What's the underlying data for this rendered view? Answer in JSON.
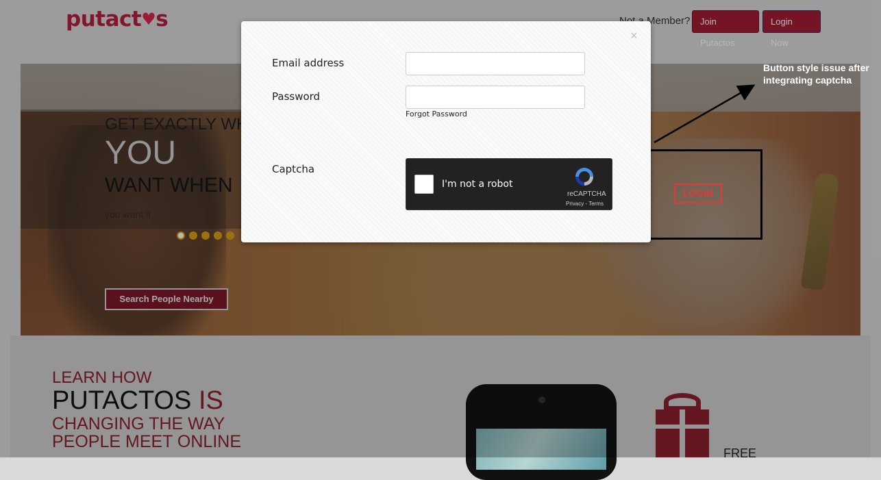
{
  "header": {
    "logo_pre": "putact",
    "logo_post": "s",
    "not_member": "Not a Member?",
    "join_label": "Join Putactos",
    "login_now_label": "Login Now"
  },
  "hero": {
    "line1": "GET EXACTLY WHA",
    "line2": "YOU",
    "line3": "WANT WHEN",
    "line4": "you want it",
    "slides_total": 5,
    "active_slide": 1,
    "search_label": "Search People Nearby"
  },
  "lower": {
    "learn1": "LEARN HOW",
    "learn2_a": "PUTACTOS",
    "learn2_b": "IS",
    "learn3": "CHANGING THE WAY",
    "learn4": "PEOPLE MEET ONLINE",
    "free": "FREE"
  },
  "modal": {
    "close": "×",
    "email_label": "Email address",
    "email_value": "",
    "password_label": "Password",
    "password_value": "",
    "forgot": "Forgot Password",
    "captcha_label": "Captcha",
    "recaptcha_text": "I'm not a robot",
    "recaptcha_brand": "reCAPTCHA",
    "recaptcha_terms": "Privacy - Terms"
  },
  "annotation": {
    "note": "Button style issue after integrating captcha",
    "login_label": "LOGIN"
  },
  "colors": {
    "brand": "#b51f3d",
    "button": "#a31c34",
    "slider_dot": "#d6a017",
    "login_outline": "#e23a3a"
  }
}
